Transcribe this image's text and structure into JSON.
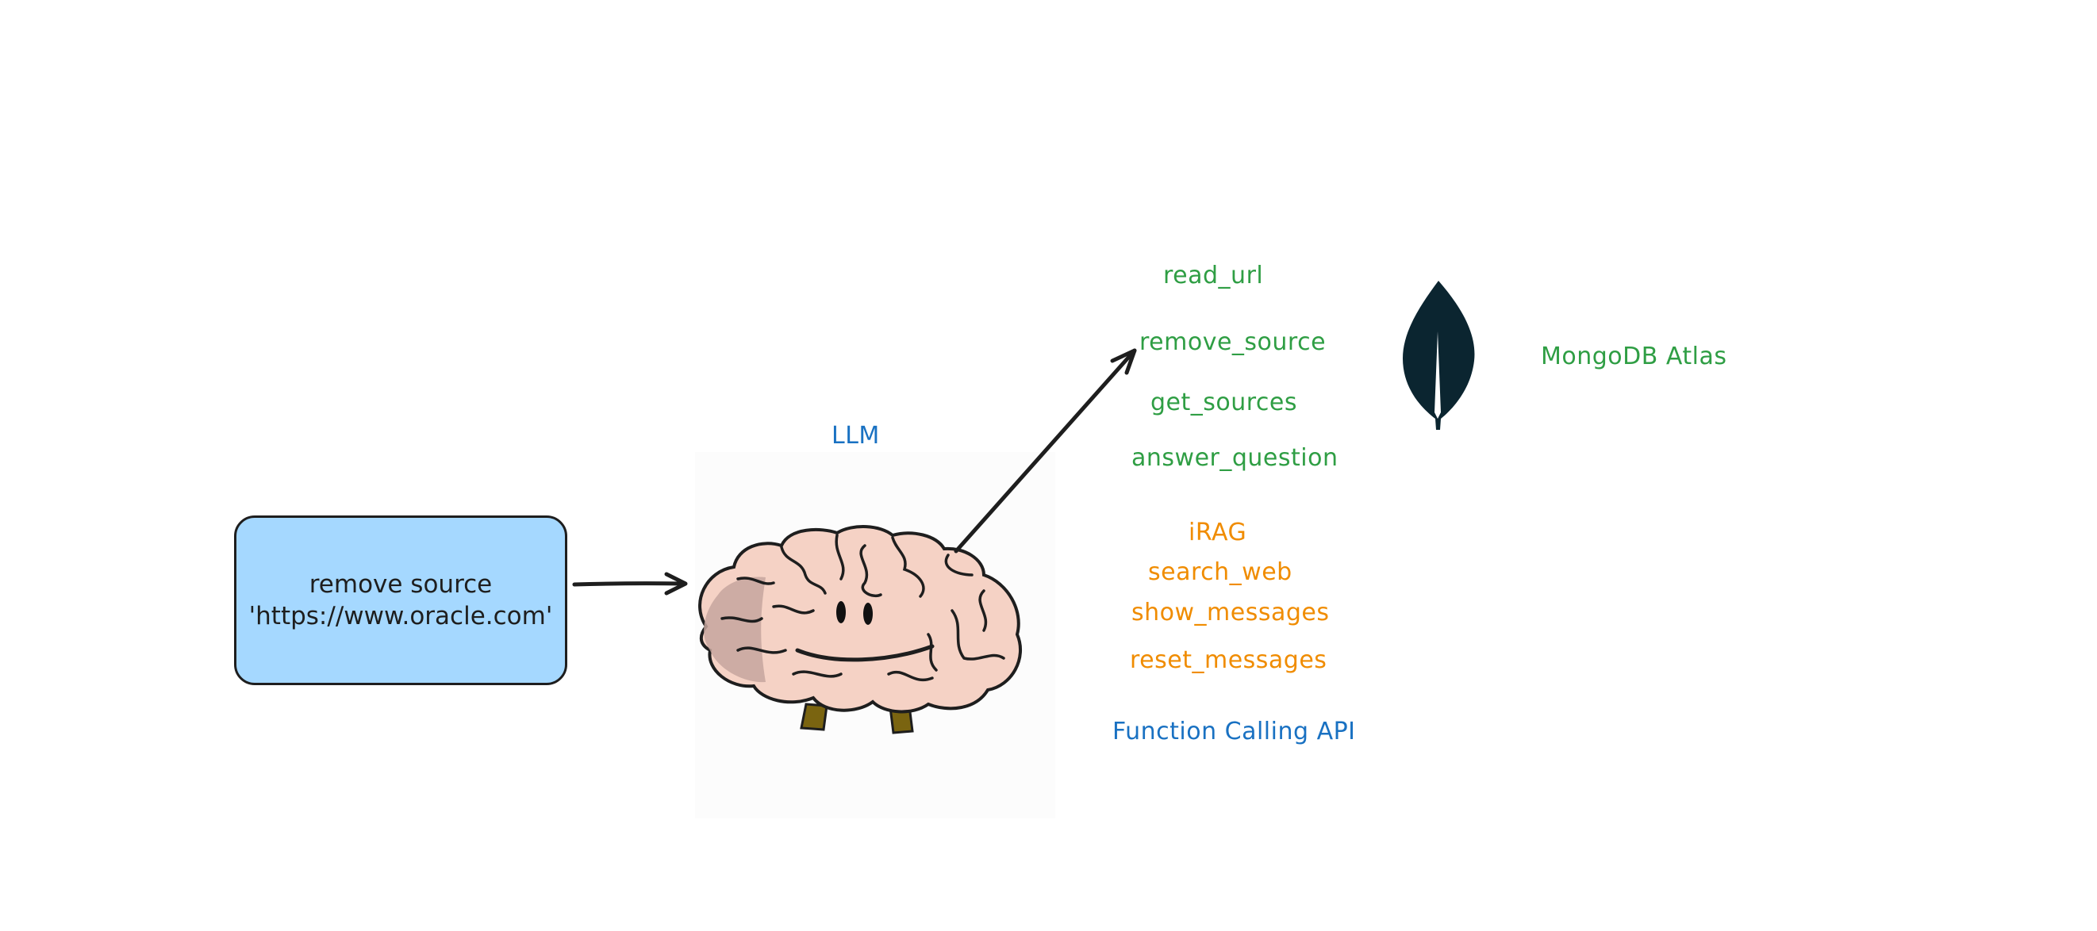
{
  "diagram": {
    "query_box": {
      "line1": "remove source",
      "line2": "'https://www.oracle.com'"
    },
    "llm": {
      "label": "LLM",
      "icon": "brain-icon"
    },
    "function_calling": {
      "label": "Function Calling API",
      "mongodb_tools": [
        "read_url",
        "remove_source",
        "get_sources",
        "answer_question"
      ],
      "other_tools": [
        "iRAG",
        "search_web",
        "show_messages",
        "reset_messages"
      ],
      "selected_tool": "remove_source"
    },
    "database": {
      "label": "MongoDB Atlas",
      "icon": "mongodb-leaf-icon"
    },
    "colors": {
      "box_fill": "#a5d8ff",
      "stroke": "#1e1e1e",
      "green": "#2f9e44",
      "orange": "#f08c00",
      "blue": "#1971c2",
      "leaf": "#0b2530"
    }
  }
}
